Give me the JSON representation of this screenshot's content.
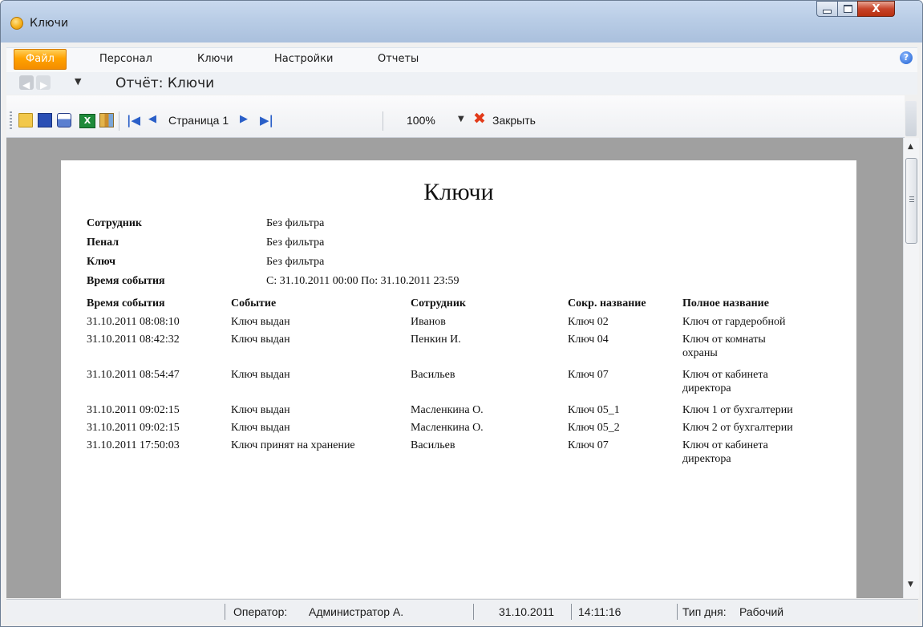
{
  "window": {
    "title": "Ключи",
    "icon": "orange-app-icon",
    "close_glyph": "X"
  },
  "menu": {
    "items": [
      "Файл",
      "Персонал",
      "Ключи",
      "Настройки",
      "Отчеты"
    ],
    "help_glyph": "?"
  },
  "nav": {
    "title": "Отчёт: Ключи"
  },
  "toolbar": {
    "page_label": "Страница 1",
    "zoom": "100%",
    "close_label": "Закрыть",
    "excel_glyph": "X",
    "first_glyph": "|◀",
    "prev_glyph": "◀",
    "next_glyph": "▶",
    "last_glyph": "▶|",
    "close_glyph": "✖",
    "icons": [
      "open-folder-icon",
      "save-icon",
      "print-icon",
      "excel-export-icon",
      "library-icon",
      "first-page-icon",
      "prev-page-icon",
      "next-page-icon",
      "last-page-icon",
      "close-icon"
    ]
  },
  "report": {
    "title": "Ключи",
    "filters": [
      {
        "label": "Сотрудник",
        "value": "Без фильтра"
      },
      {
        "label": "Пенал",
        "value": "Без фильтра"
      },
      {
        "label": "Ключ",
        "value": "Без фильтра"
      },
      {
        "label": "Время события",
        "value": "С: 31.10.2011 00:00 По: 31.10.2011 23:59"
      }
    ],
    "columns": [
      "Время события",
      "Событие",
      "Сотрудник",
      "Сокр. название",
      "Полное название"
    ],
    "rows": [
      {
        "time": "31.10.2011 08:08:10",
        "event": "Ключ выдан",
        "employee": "Иванов",
        "short": "Ключ 02",
        "full": [
          "Ключ от гардеробной"
        ]
      },
      {
        "time": "31.10.2011 08:42:32",
        "event": "Ключ выдан",
        "employee": "Пенкин И.",
        "short": "Ключ 04",
        "full": [
          "Ключ от комнаты",
          "охраны"
        ]
      },
      {
        "time": "31.10.2011 08:54:47",
        "event": "Ключ выдан",
        "employee": "Васильев",
        "short": "Ключ 07",
        "full": [
          "Ключ от кабинета",
          "директора"
        ]
      },
      {
        "time": "31.10.2011 09:02:15",
        "event": "Ключ выдан",
        "employee": "Масленкина О.",
        "short": "Ключ 05_1",
        "full": [
          "Ключ 1 от бухгалтерии"
        ]
      },
      {
        "time": "31.10.2011 09:02:15",
        "event": "Ключ выдан",
        "employee": "Масленкина О.",
        "short": "Ключ 05_2",
        "full": [
          "Ключ 2 от бухгалтерии"
        ]
      },
      {
        "time": "31.10.2011 17:50:03",
        "event": "Ключ принят на хранение",
        "employee": "Васильев",
        "short": "Ключ 07",
        "full": [
          "Ключ от кабинета",
          "директора"
        ]
      }
    ]
  },
  "status": {
    "operator_label": "Оператор:",
    "operator_value": "Администратор А.",
    "date": "31.10.2011",
    "time": "14:11:16",
    "day_label": "Тип дня:",
    "day_value": "Рабочий"
  },
  "scrollbar": {
    "up_glyph": "▲",
    "down_glyph": "▼"
  }
}
